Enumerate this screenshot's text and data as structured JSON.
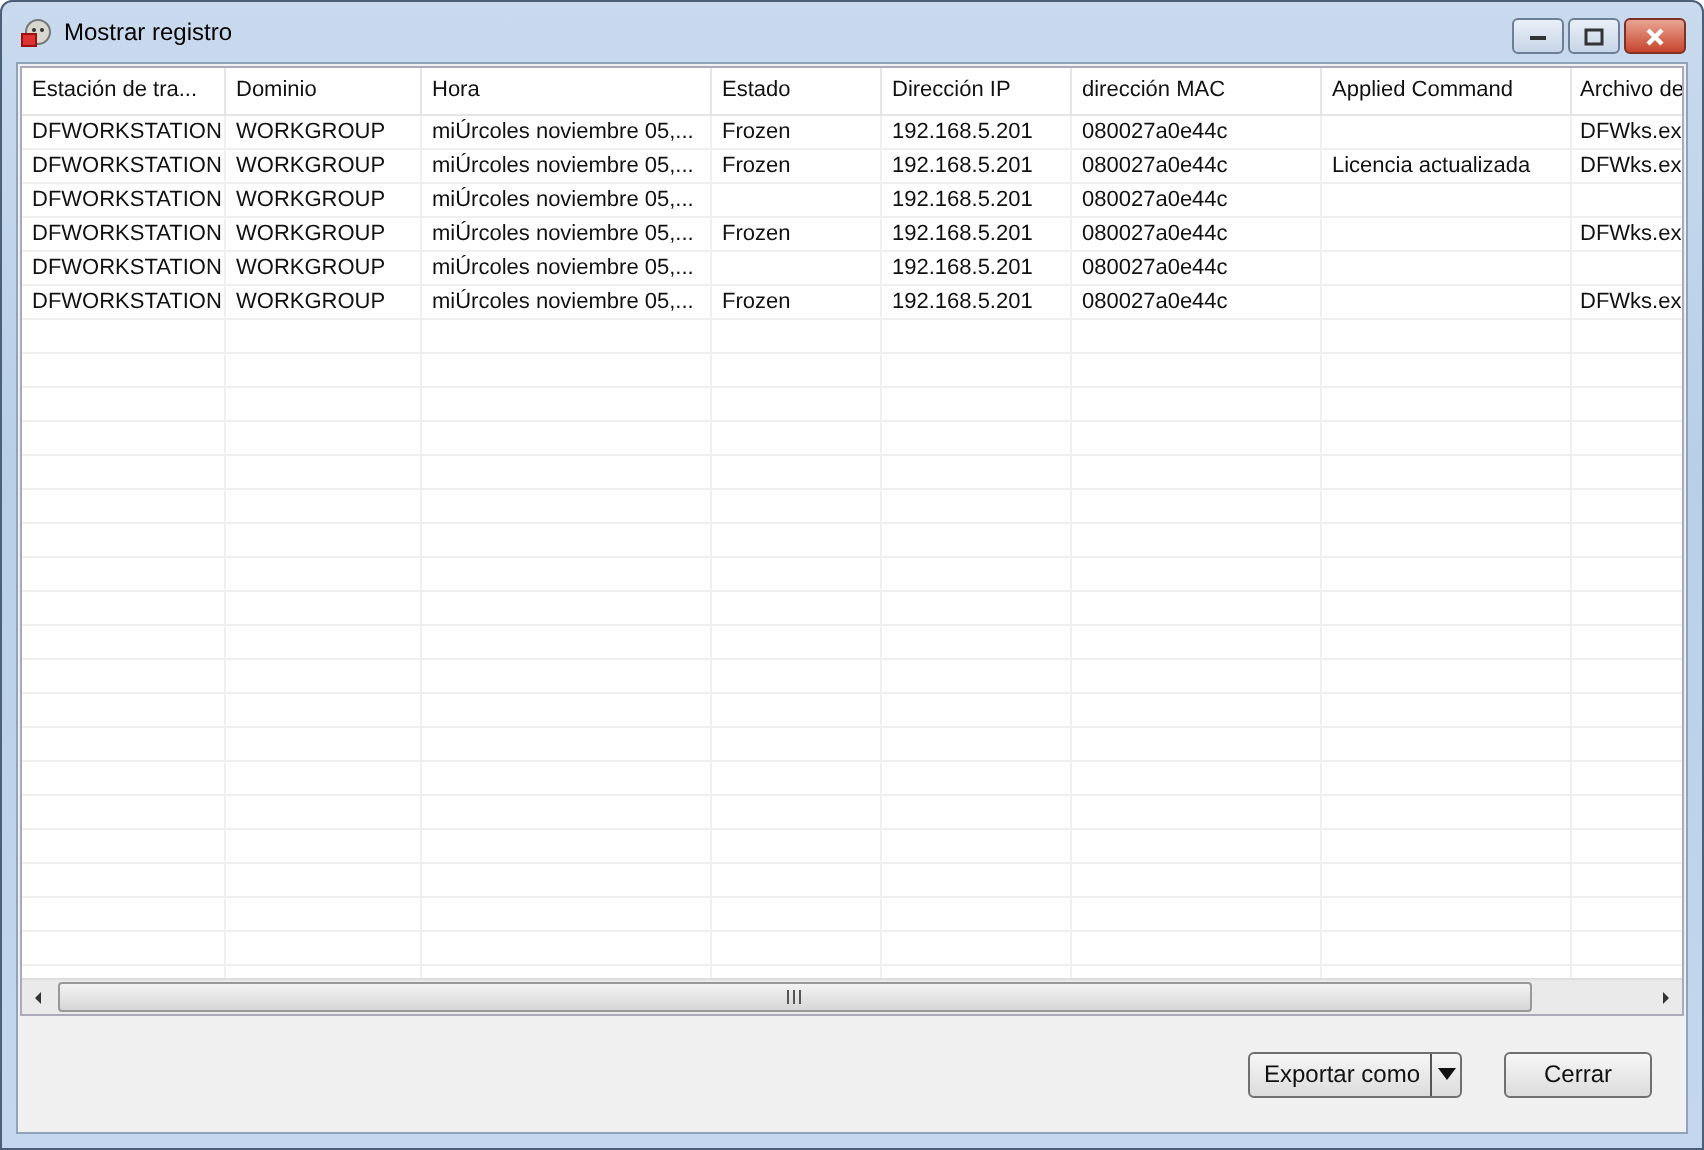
{
  "window": {
    "title": "Mostrar registro"
  },
  "table": {
    "columns": [
      "Estación de tra...",
      "Dominio",
      "Hora",
      "Estado",
      "Dirección IP",
      "dirección MAC",
      "Applied Command",
      "Archivo de"
    ],
    "rows": [
      {
        "cells": [
          "DFWORKSTATION",
          "WORKGROUP",
          "miÚrcoles noviembre 05,...",
          "Frozen",
          "192.168.5.201",
          "080027a0e44c",
          null,
          "DFWks.ex"
        ]
      },
      {
        "cells": [
          "DFWORKSTATION",
          "WORKGROUP",
          "miÚrcoles noviembre 05,...",
          "Frozen",
          "192.168.5.201",
          "080027a0e44c",
          "Licencia actualizada",
          "DFWks.ex"
        ]
      },
      {
        "cells": [
          "DFWORKSTATION",
          "WORKGROUP",
          "miÚrcoles noviembre 05,...",
          null,
          "192.168.5.201",
          "080027a0e44c",
          null,
          null
        ]
      },
      {
        "cells": [
          "DFWORKSTATION",
          "WORKGROUP",
          "miÚrcoles noviembre 05,...",
          "Frozen",
          "192.168.5.201",
          "080027a0e44c",
          null,
          "DFWks.ex"
        ]
      },
      {
        "cells": [
          "DFWORKSTATION",
          "WORKGROUP",
          "miÚrcoles noviembre 05,...",
          null,
          "192.168.5.201",
          "080027a0e44c",
          null,
          null
        ]
      },
      {
        "cells": [
          "DFWORKSTATION",
          "WORKGROUP",
          "miÚrcoles noviembre 05,...",
          "Frozen",
          "192.168.5.201",
          "080027a0e44c",
          null,
          "DFWks.ex"
        ]
      }
    ]
  },
  "buttons": [
    {
      "kind": "split",
      "label": "Exportar como"
    },
    {
      "kind": "plain",
      "label": "Cerrar"
    }
  ]
}
